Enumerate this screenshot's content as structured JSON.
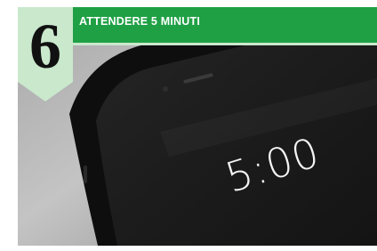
{
  "step": {
    "number": "6",
    "title": "ATTENDERE 5 MINUTI"
  },
  "phone_screen": {
    "time_display": "5:00"
  },
  "colors": {
    "banner": "#1fa045",
    "banner_underline": "#c9e8cc",
    "tag": "#c9e8cc"
  }
}
